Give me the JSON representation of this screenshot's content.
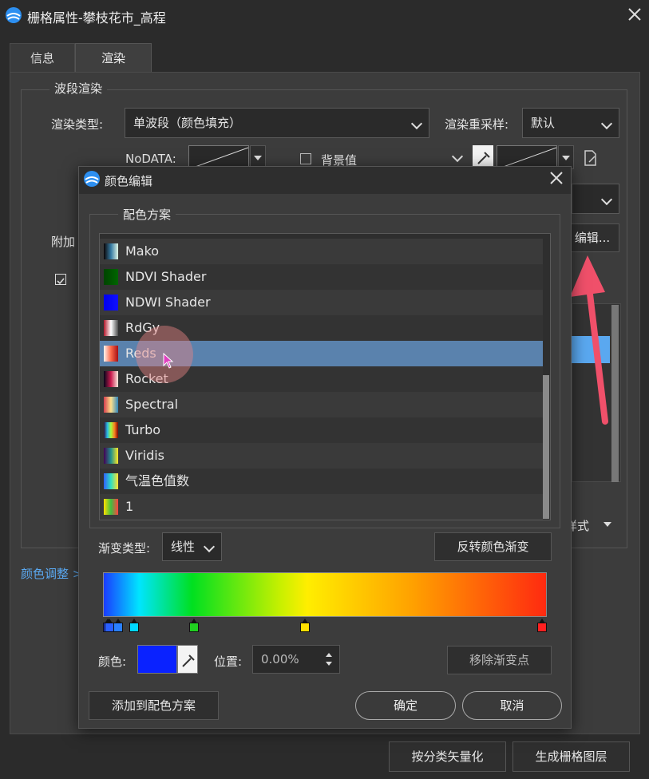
{
  "window": {
    "title": "栅格属性-攀枝花市_高程"
  },
  "tabs": [
    {
      "label": "信息"
    },
    {
      "label": "渲染"
    }
  ],
  "band_render": {
    "group_title": "波段渲染",
    "render_type_label": "渲染类型:",
    "render_type_value": "单波段（颜色填充）",
    "resample_label": "渲染重采样:",
    "resample_value": "默认",
    "nodata_label": "NoDATA:",
    "background_label": "背景值",
    "edit_button": "编辑...",
    "attach_label": "附加",
    "style_label": "样式"
  },
  "color_adjust_link": "颜色调整 >",
  "bottom_buttons": {
    "vectorize": "按分类矢量化",
    "gen_raster": "生成栅格图层"
  },
  "dialog": {
    "title": "颜色编辑",
    "scheme_title": "配色方案",
    "schemes": [
      {
        "name": "Mako",
        "swatch": "linear-gradient(to right,#0b0405,#357ba3,#def5e5)"
      },
      {
        "name": "NDVI Shader",
        "swatch": "linear-gradient(to right,#004400,#006600)"
      },
      {
        "name": "NDWI Shader",
        "swatch": "linear-gradient(to right,#0000ee,#1010ff)"
      },
      {
        "name": "RdGy",
        "swatch": "linear-gradient(to right,#b2182b,#ffffff,#4d4d4d)"
      },
      {
        "name": "Reds",
        "swatch": "linear-gradient(to right,#fff5f0,#fb6a4a,#a50f15)"
      },
      {
        "name": "Rocket",
        "swatch": "linear-gradient(to right,#03051a,#cb1b4f,#faebdd)"
      },
      {
        "name": "Spectral",
        "swatch": "linear-gradient(to right,#d53e4f,#fee08b,#3288bd)"
      },
      {
        "name": "Turbo",
        "swatch": "linear-gradient(to right,#30123b,#28bceb,#a4fc3c,#fb7e21,#7a0403)"
      },
      {
        "name": "Viridis",
        "swatch": "linear-gradient(to right,#440154,#21918c,#fde725)"
      },
      {
        "name": "气温色值数",
        "swatch": "linear-gradient(to right,#3060ff,#30e0c0,#ffe030)"
      },
      {
        "name": "1",
        "swatch": "linear-gradient(to right,#ffe000,#40c040,#ff4040)"
      }
    ],
    "selected_index": 4,
    "gradient_type_label": "渐变类型:",
    "gradient_type_value": "线性",
    "reverse_button": "反转颜色渐变",
    "color_label": "颜色:",
    "position_label": "位置:",
    "position_value": "0.00%",
    "remove_stop_button": "移除渐变点",
    "add_scheme_button": "添加到配色方案",
    "ok_button": "确定",
    "cancel_button": "取消",
    "stops": [
      {
        "pos": 0.0,
        "color": "#1a3cff"
      },
      {
        "pos": 0.015,
        "color": "#2a60ff"
      },
      {
        "pos": 0.035,
        "color": "#2a80ff"
      },
      {
        "pos": 0.07,
        "color": "#00d8ff"
      },
      {
        "pos": 0.205,
        "color": "#20d020"
      },
      {
        "pos": 0.455,
        "color": "#ffe000"
      },
      {
        "pos": 0.995,
        "color": "#ff2020"
      }
    ],
    "selected_color": "#0a22ff"
  }
}
